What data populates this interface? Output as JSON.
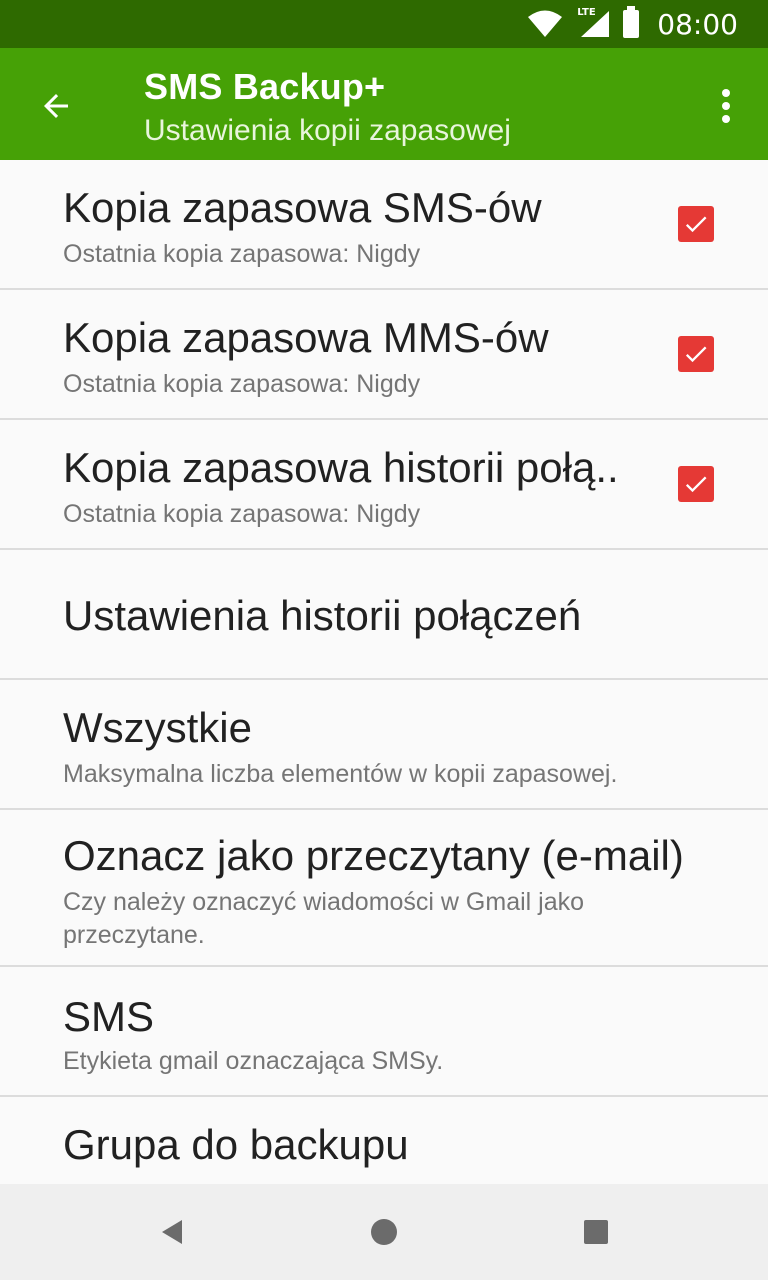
{
  "status_bar": {
    "network_label": "LTE",
    "time": "08:00"
  },
  "toolbar": {
    "title": "SMS Backup+",
    "subtitle": "Ustawienia kopii zapasowej"
  },
  "preferences": [
    {
      "title": "Kopia zapasowa SMS-ów",
      "summary": "Ostatnia kopia zapasowa: Nigdy",
      "checked": true
    },
    {
      "title": "Kopia zapasowa MMS-ów",
      "summary": "Ostatnia kopia zapasowa: Nigdy",
      "checked": true
    },
    {
      "title": "Kopia zapasowa historii połą..",
      "summary": "Ostatnia kopia zapasowa: Nigdy",
      "checked": true
    },
    {
      "title": "Ustawienia historii połączeń"
    },
    {
      "title": "Wszystkie",
      "summary": "Maksymalna liczba elementów w kopii zapasowej."
    },
    {
      "title": "Oznacz jako przeczytany (e-mail)",
      "summary": "Czy należy oznaczyć wiadomości w Gmail jako przeczytane."
    },
    {
      "title": "SMS",
      "summary": "Etykieta gmail oznaczająca SMSy."
    },
    {
      "title": "Grupa do backupu"
    }
  ],
  "colors": {
    "status_bar": "#2e6a00",
    "toolbar": "#46a106",
    "checkbox": "#e53935"
  }
}
